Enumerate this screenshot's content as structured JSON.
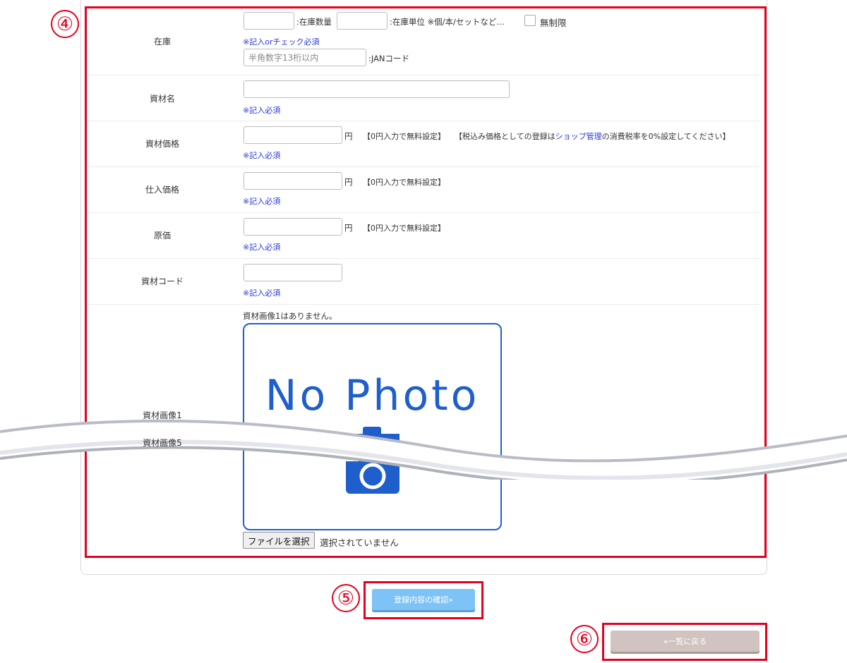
{
  "markers": {
    "form": "④",
    "confirm": "⑤",
    "back": "⑥"
  },
  "stock": {
    "label": "在庫",
    "qty_suffix": ":在庫数量",
    "unit_suffix": ":在庫単位 ※個/本/セットなど…",
    "unlimited_label": "無制限",
    "required_note": "※記入orチェック必須",
    "jan_placeholder": "半角数字13桁以内",
    "jan_suffix": ":JANコード"
  },
  "material_name": {
    "label": "資材名",
    "required_note": "※記入必須"
  },
  "material_price": {
    "label": "資材価格",
    "unit": "円",
    "hint_free": "【0円入力で無料設定】",
    "hint_tax_before": "【税込み価格としての登録は",
    "hint_tax_link": "ショップ管理",
    "hint_tax_after": "の消費税率を0%設定してください】",
    "required_note": "※記入必須"
  },
  "purchase_price": {
    "label": "仕入価格",
    "unit": "円",
    "hint_free": "【0円入力で無料設定】",
    "required_note": "※記入必須"
  },
  "cost_price": {
    "label": "原価",
    "unit": "円",
    "hint_free": "【0円入力で無料設定】",
    "required_note": "※記入必須"
  },
  "material_code": {
    "label": "資材コード",
    "required_note": "※記入必須"
  },
  "material_image": {
    "label_first": "資材画像1",
    "label_last": "資材画像5",
    "none_text": "資材画像1はありません。",
    "placeholder_text": "No Photo",
    "file_button": "ファイルを選択",
    "file_status": "選択されていません"
  },
  "buttons": {
    "confirm": "登録内容の確認»",
    "back": "«一覧に戻る"
  },
  "colors": {
    "accent_red": "#e6001e",
    "photo_blue": "#1f5fcc",
    "link_blue": "#2a39d6",
    "confirm_bg": "#7ec3f5",
    "back_bg": "#d1c3bf"
  }
}
